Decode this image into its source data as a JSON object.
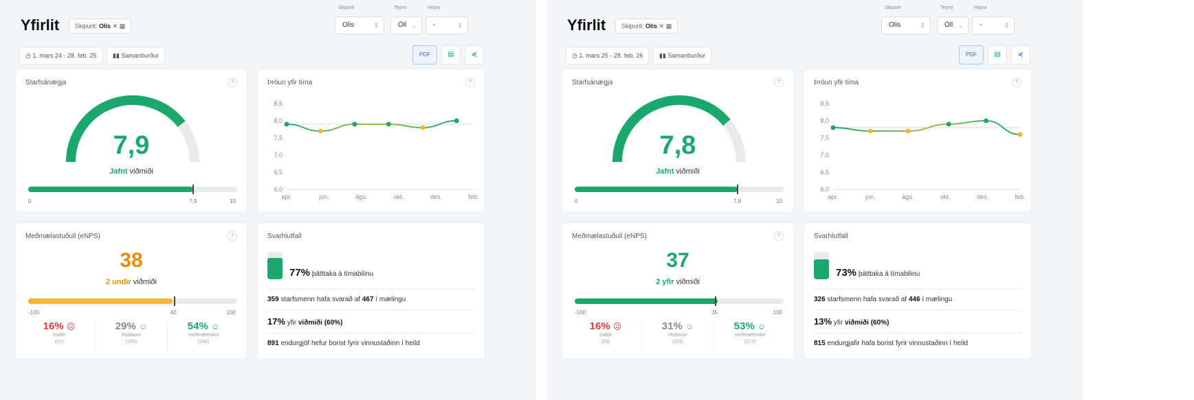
{
  "colors": {
    "green": "#1aa86d",
    "yellow": "#f5b82e",
    "orange": "#e88c0c",
    "red": "#e03a3a",
    "gray": "#8a8a8a",
    "track": "#e8eaee"
  },
  "panels": [
    {
      "title": "Yfirlit",
      "filter_chip": {
        "prefix": "Skipurit:",
        "value": "Olis"
      },
      "filters": {
        "labels": [
          "Skipurit",
          "Teymi",
          "Hópur"
        ],
        "values": [
          "Olis",
          "Öll",
          "-"
        ]
      },
      "date_range": "1. mars 24 - 28. feb. 25",
      "compare_label": "Samanburður",
      "export": {
        "pdf": "PDF"
      },
      "satisfaction": {
        "title": "Starfsánægja",
        "value": "7,9",
        "score": 7.9,
        "max": 10,
        "comparison_strong": "Jafnt",
        "comparison_rest": "viðmiði",
        "min_label": "0",
        "mark_label": "7,9",
        "max_label": "10"
      },
      "trend": {
        "title": "Þróun yfir tíma"
      },
      "enps": {
        "title": "Meðmælastuðull (eNPS)",
        "value": "38",
        "score": 38,
        "comparison_strong": "2 undir",
        "comparison_rest": "viðmiði",
        "min_label": "-100",
        "mark_label": "40",
        "mark_value": 40,
        "max_label": "100",
        "stats": [
          {
            "pct": "16%",
            "face": "☹",
            "label": "ósáttir",
            "count": "(57)",
            "tone": "red"
          },
          {
            "pct": "29%",
            "face": "☺",
            "label": "hlutlausir",
            "count": "(105)",
            "tone": "gray"
          },
          {
            "pct": "54%",
            "face": "☺",
            "label": "meðmælendur",
            "count": "(194)",
            "tone": "green"
          }
        ]
      },
      "response": {
        "title": "Svarhlutfall",
        "participation_pct": "77%",
        "participation_value": 0.77,
        "participation_text": "þátttaka á tímabilinu",
        "answered_count": "359",
        "answered_text_a": "starfsmenn hafa svarað af",
        "total_count": "467",
        "answered_text_b": "í mælingu",
        "delta_pct": "17%",
        "delta_word": "yfir",
        "delta_benchmark": "viðmiði (60%)",
        "feedback_count": "891",
        "feedback_text": "endurgjöf hefur borist fyrir vinnustaðinn í heild"
      }
    },
    {
      "title": "Yfirlit",
      "filter_chip": {
        "prefix": "Skipurit:",
        "value": "Olis"
      },
      "filters": {
        "labels": [
          "Skipurit",
          "Teymi",
          "Hópur"
        ],
        "values": [
          "Olis",
          "Öll",
          "-"
        ]
      },
      "date_range": "1. mars 25 - 28. feb. 26",
      "compare_label": "Samanburður",
      "export": {
        "pdf": "PDF"
      },
      "satisfaction": {
        "title": "Starfsánægja",
        "value": "7,8",
        "score": 7.8,
        "max": 10,
        "comparison_strong": "Jafnt",
        "comparison_rest": "viðmiði",
        "min_label": "0",
        "mark_label": "7,8",
        "max_label": "10"
      },
      "trend": {
        "title": "Þróun yfir tíma"
      },
      "enps": {
        "title": "Meðmælastuðull (eNPS)",
        "value": "37",
        "score": 37,
        "comparison_strong": "2 yfir",
        "comparison_rest": "viðmiði",
        "min_label": "-100",
        "mark_label": "35",
        "mark_value": 35,
        "max_label": "100",
        "stats": [
          {
            "pct": "16%",
            "face": "☹",
            "label": "ósáttir",
            "count": "(52)",
            "tone": "red"
          },
          {
            "pct": "31%",
            "face": "☺",
            "label": "hlutlausir",
            "count": "(102)",
            "tone": "gray"
          },
          {
            "pct": "53%",
            "face": "☺",
            "label": "meðmælendur",
            "count": "(172)",
            "tone": "green"
          }
        ]
      },
      "response": {
        "title": "Svarhlutfall",
        "participation_pct": "73%",
        "participation_value": 0.73,
        "participation_text": "þátttaka á tímabilinu",
        "answered_count": "326",
        "answered_text_a": "starfsmenn hafa svarað af",
        "total_count": "446",
        "answered_text_b": "í mælingu",
        "delta_pct": "13%",
        "delta_word": "yfir",
        "delta_benchmark": "viðmiði (60%)",
        "feedback_count": "815",
        "feedback_text": "endurgjafir hafa borist fyrir vinnustaðinn í heild"
      }
    }
  ],
  "chart_data": [
    {
      "type": "line",
      "title": "Þróun yfir tíma",
      "categories": [
        "apr.",
        "jún.",
        "ágú.",
        "okt.",
        "des.",
        "feb."
      ],
      "x": [
        0,
        1,
        2,
        3,
        4,
        5
      ],
      "values": [
        7.9,
        7.7,
        7.9,
        7.9,
        7.8,
        8.0
      ],
      "point_colors": [
        "green",
        "yellow",
        "green",
        "green",
        "yellow",
        "green"
      ],
      "reference": 7.9,
      "ylim": [
        6.0,
        8.5
      ],
      "yticks": [
        "8,5",
        "8,0",
        "7,5",
        "7,0",
        "6,5",
        "6,0"
      ],
      "grid": false
    },
    {
      "type": "line",
      "title": "Þróun yfir tíma",
      "categories": [
        "apr.",
        "jún.",
        "ágú.",
        "okt.",
        "des.",
        "feb."
      ],
      "x": [
        0,
        1.1,
        2.2,
        3.4,
        4.5,
        5.5
      ],
      "values": [
        7.8,
        7.7,
        7.7,
        7.9,
        8.0,
        7.6
      ],
      "point_colors": [
        "green",
        "yellow",
        "yellow",
        "green",
        "green",
        "yellow"
      ],
      "reference": 7.8,
      "ylim": [
        6.0,
        8.5
      ],
      "yticks": [
        "8,5",
        "8,0",
        "7,5",
        "7,0",
        "6,5",
        "6,0"
      ],
      "grid": false
    }
  ]
}
